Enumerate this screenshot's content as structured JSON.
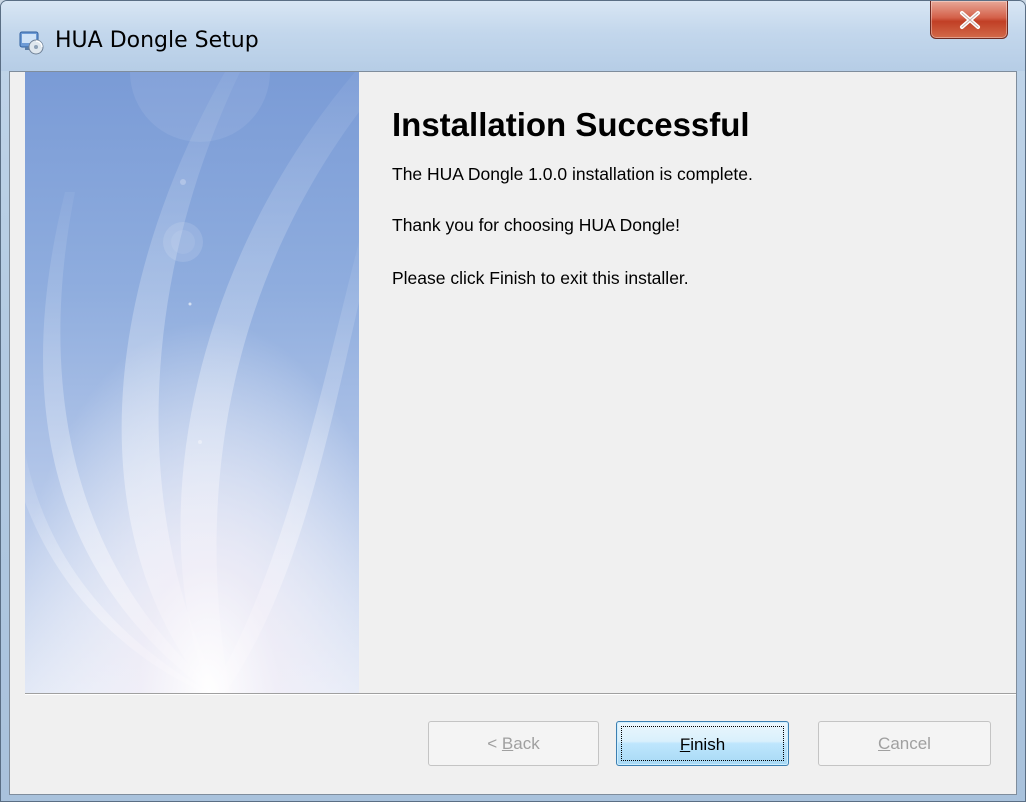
{
  "window": {
    "title": "HUA Dongle Setup",
    "title_icon": "installer-icon",
    "close_icon": "close-icon",
    "close_color": "#c13f25"
  },
  "page": {
    "heading": "Installation Successful",
    "paragraphs": [
      "The HUA Dongle 1.0.0 installation is complete.",
      "Thank you for choosing HUA Dongle!",
      "Please click Finish to exit this installer."
    ]
  },
  "buttons": {
    "back": {
      "prefix": "< ",
      "accel": "B",
      "rest": "ack",
      "enabled": false
    },
    "finish": {
      "prefix": "",
      "accel": "F",
      "rest": "inish",
      "enabled": true,
      "default": true
    },
    "cancel": {
      "prefix": "",
      "accel": "C",
      "rest": "ancel",
      "enabled": false
    }
  }
}
